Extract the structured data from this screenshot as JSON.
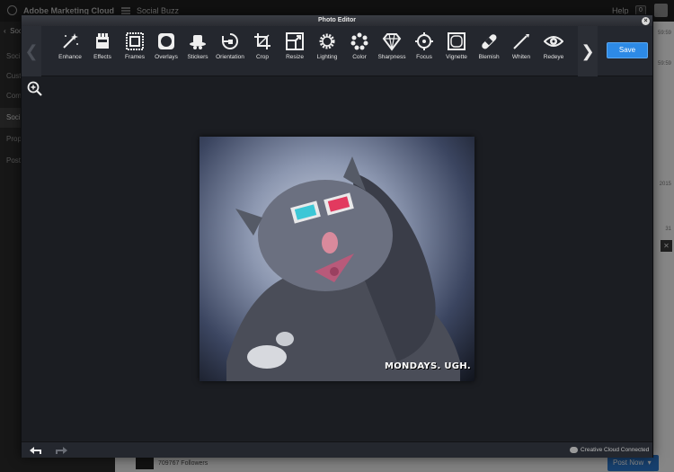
{
  "app": {
    "title": "Adobe Marketing Cloud",
    "section": "Social Buzz",
    "help": "Help",
    "notification_count": "0"
  },
  "sidebar": {
    "items": [
      {
        "label": "Soci",
        "active": false
      },
      {
        "label": "Cust",
        "active": false
      },
      {
        "label": "Com",
        "active": false
      },
      {
        "label": "Soci",
        "active": true
      },
      {
        "label": "Prop",
        "active": false
      },
      {
        "label": "Post",
        "active": false
      }
    ]
  },
  "background": {
    "followers": "709767 Followers",
    "post_now": "Post Now",
    "right_texts": [
      "59:59",
      "59:59",
      "2015",
      "31"
    ]
  },
  "editor": {
    "title": "Photo Editor",
    "save_label": "Save",
    "tools": [
      {
        "label": "Enhance",
        "icon": "magic-wand-icon"
      },
      {
        "label": "Effects",
        "icon": "effects-icon"
      },
      {
        "label": "Frames",
        "icon": "frame-icon"
      },
      {
        "label": "Overlays",
        "icon": "overlay-icon"
      },
      {
        "label": "Stickers",
        "icon": "sticker-hat-icon"
      },
      {
        "label": "Orientation",
        "icon": "rotate-icon"
      },
      {
        "label": "Crop",
        "icon": "crop-icon"
      },
      {
        "label": "Resize",
        "icon": "resize-icon"
      },
      {
        "label": "Lighting",
        "icon": "sun-icon"
      },
      {
        "label": "Color",
        "icon": "color-icon"
      },
      {
        "label": "Sharpness",
        "icon": "diamond-icon"
      },
      {
        "label": "Focus",
        "icon": "focus-icon"
      },
      {
        "label": "Vignette",
        "icon": "vignette-icon"
      },
      {
        "label": "Blemish",
        "icon": "bandage-icon"
      },
      {
        "label": "Whiten",
        "icon": "brush-icon"
      },
      {
        "label": "Redeye",
        "icon": "eye-icon"
      }
    ],
    "photo_caption": "MONDAYS. UGH.",
    "status": "Creative Cloud Connected"
  }
}
